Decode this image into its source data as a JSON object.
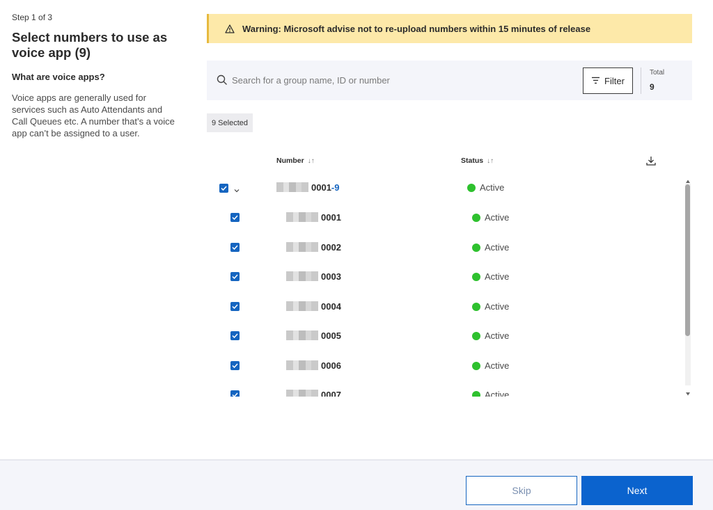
{
  "left": {
    "step": "Step 1 of 3",
    "title": "Select numbers to use as voice app (9)",
    "subtitle": "What are voice apps?",
    "description": "Voice apps are generally used for services such as Auto Attendants and Call Queues etc. A number that’s a voice app can’t be assigned to a user."
  },
  "warning": {
    "icon": "warning-triangle-icon",
    "text": "Warning: Microsoft advise not to re-upload numbers within 15 minutes of release"
  },
  "search": {
    "placeholder": "Search for a group name, ID or number",
    "value": "",
    "filter_label": "Filter",
    "total_label": "Total",
    "total_value": "9"
  },
  "selected_chip": "9 Selected",
  "table": {
    "columns": [
      {
        "label": "Number",
        "sort_icon": "↓↑"
      },
      {
        "label": "Status",
        "sort_icon": "↓↑"
      }
    ],
    "group_row": {
      "number_prefix": "0001",
      "number_range": "-9",
      "status": "Active",
      "checked": true,
      "expanded": true
    },
    "rows": [
      {
        "number": "0001",
        "status": "Active",
        "checked": true
      },
      {
        "number": "0002",
        "status": "Active",
        "checked": true
      },
      {
        "number": "0003",
        "status": "Active",
        "checked": true
      },
      {
        "number": "0004",
        "status": "Active",
        "checked": true
      },
      {
        "number": "0005",
        "status": "Active",
        "checked": true
      },
      {
        "number": "0006",
        "status": "Active",
        "checked": true
      },
      {
        "number": "0007",
        "status": "Active",
        "checked": true
      }
    ]
  },
  "footer": {
    "skip_label": "Skip",
    "next_label": "Next"
  },
  "colors": {
    "accent": "#0b63ce",
    "warning_bg": "#fde9a9",
    "active_dot": "#2ec12e"
  }
}
